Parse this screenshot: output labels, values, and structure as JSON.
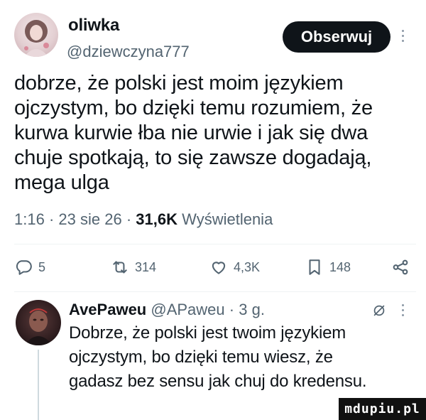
{
  "tweet": {
    "display_name": "oliwka",
    "handle": "@dziewczyna777",
    "follow_label": "Obserwuj",
    "text": "dobrze, że polski jest moim językiem\nojczystym, bo dzięki temu rozumiem, że\nkurwa kurwie łba nie urwie i jak się dwa\nchuje spotkają, to się zawsze dogadają,\nmega ulga",
    "time": "1:16",
    "date": "23 sie 26",
    "views_count": "31,6K",
    "views_label": "Wyświetlenia",
    "separator": "·"
  },
  "actions": {
    "replies": "5",
    "retweets": "314",
    "likes": "4,3K",
    "bookmarks": "148"
  },
  "reply": {
    "display_name": "AvePaweu",
    "handle": "@APaweu",
    "age": "3 g.",
    "text": "Dobrze, że polski jest twoim językiem\nojczystym, bo dzięki temu wiesz, że\ngadasz bez sensu jak chuj do kredensu."
  },
  "watermark": "mdupiu.pl",
  "icons": [
    "avatar",
    "more-icon",
    "reply-icon",
    "retweet-icon",
    "like-icon",
    "bookmark-icon",
    "share-icon",
    "grok-icon"
  ],
  "colors": {
    "text": "#0f1419",
    "secondary": "#536471",
    "button": "#0f1419",
    "divider": "#eff3f4"
  }
}
